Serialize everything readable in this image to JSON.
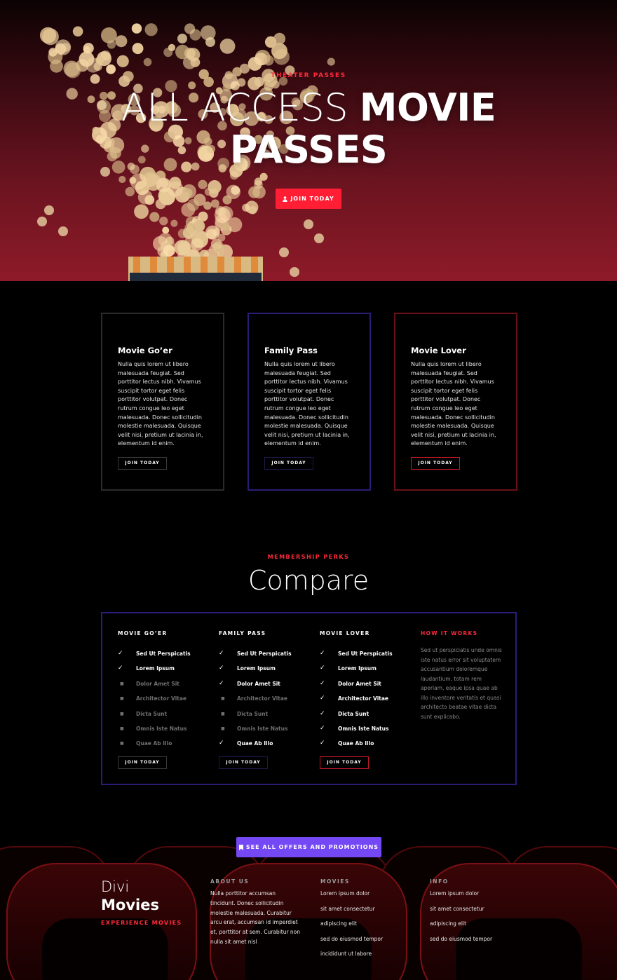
{
  "hero": {
    "tag": "THEATER PASSES",
    "title_light": "ALL ACCESS",
    "title_bold_1": "MOVIE",
    "title_bold_2": "PASSES",
    "button": "JOIN TODAY",
    "button_icon": "user-icon"
  },
  "cards": [
    {
      "title": "Movie Go’er",
      "body": "Nulla quis lorem ut libero malesuada feugiat. Sed porttitor lectus nibh. Vivamus suscipit tortor eget felis porttitor volutpat. Donec rutrum congue leo eget malesuada. Donec sollicitudin molestie malesuada. Quisque velit nisi, pretium ut lacinia in, elementum id enim.",
      "button": "JOIN TODAY",
      "accent": "#2b2b2b"
    },
    {
      "title": "Family Pass",
      "body": "Nulla quis lorem ut libero malesuada feugiat. Sed porttitor lectus nibh. Vivamus suscipit tortor eget felis porttitor volutpat. Donec rutrum congue leo eget malesuada. Donec sollicitudin molestie malesuada. Quisque velit nisi, pretium ut lacinia in, elementum id enim.",
      "button": "JOIN TODAY",
      "accent": "#2a1d78"
    },
    {
      "title": "Movie Lover",
      "body": "Nulla quis lorem ut libero malesuada feugiat. Sed porttitor lectus nibh. Vivamus suscipit tortor eget felis porttitor volutpat. Donec rutrum congue leo eget malesuada. Donec sollicitudin molestie malesuada. Quisque velit nisi, pretium ut lacinia in, elementum id enim.",
      "button": "JOIN TODAY",
      "accent": "#6a1118"
    }
  ],
  "compare": {
    "tag": "MEMBERSHIP PERKS",
    "title": "Compare",
    "columns": [
      {
        "title": "MOVIE GO’ER",
        "button": "JOIN TODAY",
        "items": [
          {
            "label": "Sed Ut Perspicatis",
            "included": true
          },
          {
            "label": "Lorem Ipsum",
            "included": true
          },
          {
            "label": "Dolor Amet Sit",
            "included": false
          },
          {
            "label": "Architector Vitae",
            "included": false
          },
          {
            "label": "Dicta Sunt",
            "included": false
          },
          {
            "label": "Omnis Iste Natus",
            "included": false
          },
          {
            "label": "Quae Ab Illo",
            "included": false
          }
        ]
      },
      {
        "title": "FAMILY PASS",
        "button": "JOIN TODAY",
        "items": [
          {
            "label": "Sed Ut Perspicatis",
            "included": true
          },
          {
            "label": "Lorem Ipsum",
            "included": true
          },
          {
            "label": "Dolor Amet Sit",
            "included": true
          },
          {
            "label": "Architector Vitae",
            "included": false
          },
          {
            "label": "Dicta Sunt",
            "included": false
          },
          {
            "label": "Omnis Iste Natus",
            "included": false
          },
          {
            "label": "Quae Ab Illo",
            "included": true
          }
        ]
      },
      {
        "title": "MOVIE LOVER",
        "button": "JOIN TODAY",
        "items": [
          {
            "label": "Sed Ut Perspicatis",
            "included": true
          },
          {
            "label": "Lorem Ipsum",
            "included": true
          },
          {
            "label": "Dolor Amet Sit",
            "included": true
          },
          {
            "label": "Architector Vitae",
            "included": true
          },
          {
            "label": "Dicta Sunt",
            "included": true
          },
          {
            "label": "Omnis Iste Natus",
            "included": true
          },
          {
            "label": "Quae Ab Illo",
            "included": true
          }
        ]
      }
    ],
    "how": {
      "title": "HOW IT WORKS",
      "body": "Sed ut perspiciatis unde omnis iste natus error sit voluptatem accusantium doloremque laudantium, totam rem aperiam, eaque ipsa quae ab illo inventore veritatis et quasi architecto beatae vitae dicta sunt explicabo."
    }
  },
  "offers_button": "SEE ALL OFFERS AND PROMOTIONS",
  "offers_icon": "bookmark-icon",
  "footer": {
    "brand_line1": "Divi",
    "brand_line2": "Movies",
    "brand_tagline": "EXPERIENCE MOVIES",
    "about": {
      "title": "ABOUT US",
      "body": "Nulla porttitor accumsan tincidunt. Donec sollicitudin molestie malesuada. Curabitur arcu erat, accumsan id imperdiet et, porttitor at sem. Curabitur non nulla sit amet nisl"
    },
    "movies": {
      "title": "MOVIES",
      "links": [
        "Lorem ipsum dolor",
        "sit amet consectetur",
        "adipiscing elit",
        "sed do eiusmod tempor",
        "incididunt ut labore"
      ]
    },
    "info": {
      "title": "INFO",
      "links": [
        "Lorem ipsum dolor",
        "sit amet consectetur",
        "adipiscing elit",
        "sed do eiusmod tempor"
      ]
    }
  },
  "colors": {
    "accent_red": "#ff1e33",
    "accent_purple": "#7448f5",
    "card_blue": "#2a1d78",
    "card_red": "#6a1118"
  }
}
